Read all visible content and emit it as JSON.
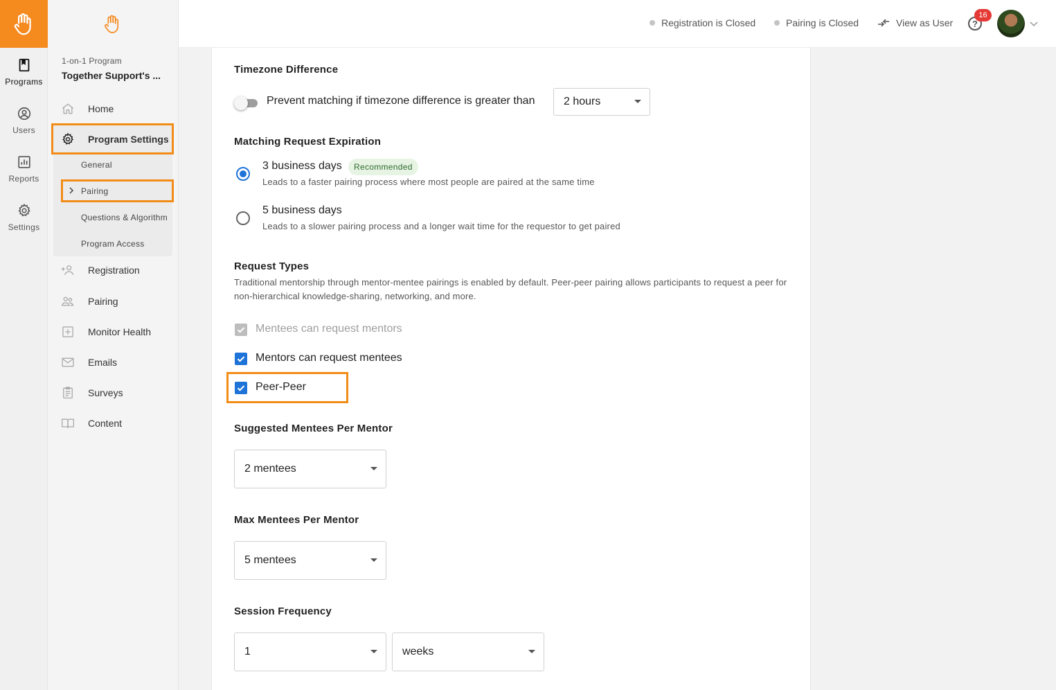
{
  "colors": {
    "brand_orange": "#f58a1f",
    "accent_blue": "#1e73d8",
    "highlight": "#f28c16",
    "badge_red": "#e53935"
  },
  "rail": {
    "items": [
      {
        "label": "Programs",
        "icon": "bookmark-icon"
      },
      {
        "label": "Users",
        "icon": "user-circle-icon"
      },
      {
        "label": "Reports",
        "icon": "bar-chart-icon"
      },
      {
        "label": "Settings",
        "icon": "gear-icon"
      }
    ]
  },
  "sidenav": {
    "program_type": "1-on-1 Program",
    "program_name": "Together Support's ...",
    "home": "Home",
    "program_settings": "Program Settings",
    "sub_items": [
      "General",
      "Pairing",
      "Questions & Algorithm",
      "Program Access"
    ],
    "items": [
      "Registration",
      "Pairing",
      "Monitor Health",
      "Emails",
      "Surveys",
      "Content"
    ]
  },
  "topbar": {
    "registration_status": "Registration is Closed",
    "pairing_status": "Pairing is Closed",
    "view_as_user": "View as User",
    "help_glyph": "?",
    "notification_count": "16"
  },
  "main": {
    "timezone": {
      "title": "Timezone Difference",
      "toggle_label": "Prevent matching if timezone difference is greater than",
      "toggle_on": false,
      "select_value": "2 hours"
    },
    "expiration": {
      "title": "Matching Request Expiration",
      "options": [
        {
          "label": "3 business days",
          "helptext": "Leads to a faster pairing process where most people are paired at the same time",
          "selected": true,
          "badge": "Recommended"
        },
        {
          "label": "5 business days",
          "helptext": "Leads to a slower pairing process and a longer wait time for the requestor to get paired",
          "selected": false
        }
      ]
    },
    "request_types": {
      "title": "Request Types",
      "description": "Traditional mentorship through mentor-mentee pairings is enabled by default. Peer-peer pairing allows participants to request a peer for non-hierarchical knowledge-sharing, networking, and more.",
      "options": [
        {
          "label": "Mentees can request mentors",
          "checked": true,
          "disabled": true
        },
        {
          "label": "Mentors can request mentees",
          "checked": true,
          "disabled": false
        },
        {
          "label": "Peer-Peer",
          "checked": true,
          "disabled": false
        }
      ]
    },
    "suggested": {
      "title": "Suggested Mentees Per Mentor",
      "value": "2 mentees"
    },
    "max": {
      "title": "Max Mentees Per Mentor",
      "value": "5 mentees"
    },
    "frequency": {
      "title": "Session Frequency",
      "count": "1",
      "unit": "weeks"
    }
  }
}
